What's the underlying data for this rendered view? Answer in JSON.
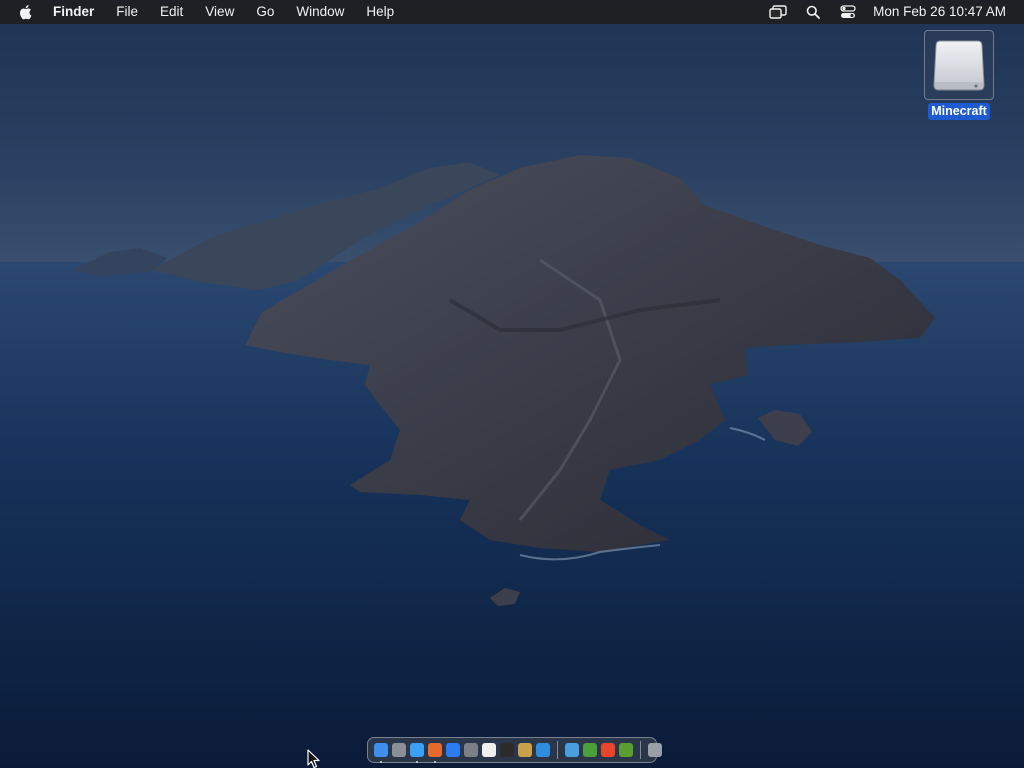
{
  "menubar": {
    "apple_icon": "apple-logo-icon",
    "app_name": "Finder",
    "menus": [
      "File",
      "Edit",
      "View",
      "Go",
      "Window",
      "Help"
    ],
    "status_icons": [
      "screen-mirroring-icon",
      "spotlight-search-icon",
      "control-center-icon"
    ],
    "clock": "Mon Feb 26  10:47 AM"
  },
  "desktop": {
    "wallpaper": "macOS Catalina island at dusk",
    "icons": [
      {
        "label": "Minecraft",
        "icon": "external-drive-icon",
        "selected": true
      }
    ]
  },
  "dock": {
    "apps": [
      {
        "name": "finder-icon",
        "color": "#3d8ff0",
        "running": true
      },
      {
        "name": "launchpad-icon",
        "color": "#8a8f9a",
        "running": false
      },
      {
        "name": "safari-icon",
        "color": "#3aa0f5",
        "running": true
      },
      {
        "name": "firefox-icon",
        "color": "#e66a2c",
        "running": true
      },
      {
        "name": "app-store-icon",
        "color": "#2a7cf0",
        "running": false
      },
      {
        "name": "system-preferences-icon",
        "color": "#7d7f86",
        "running": false
      },
      {
        "name": "textedit-icon",
        "color": "#f0f0f0",
        "running": false
      },
      {
        "name": "terminal-icon",
        "color": "#2b2b2b",
        "running": false
      },
      {
        "name": "paintbrush-icon",
        "color": "#c8a14a",
        "running": false
      },
      {
        "name": "vscode-icon",
        "color": "#2f8de0",
        "running": false
      }
    ],
    "recent_apps": [
      {
        "name": "mail-cloud-icon",
        "color": "#4a9ee0",
        "running": false
      },
      {
        "name": "minecraft-launcher-icon",
        "color": "#4aa03a",
        "running": false
      },
      {
        "name": "firefox-alt-icon",
        "color": "#e8452c",
        "running": false
      },
      {
        "name": "minecraft-icon",
        "color": "#5a9e32",
        "running": false
      }
    ],
    "trash_icon": "trash-icon"
  }
}
